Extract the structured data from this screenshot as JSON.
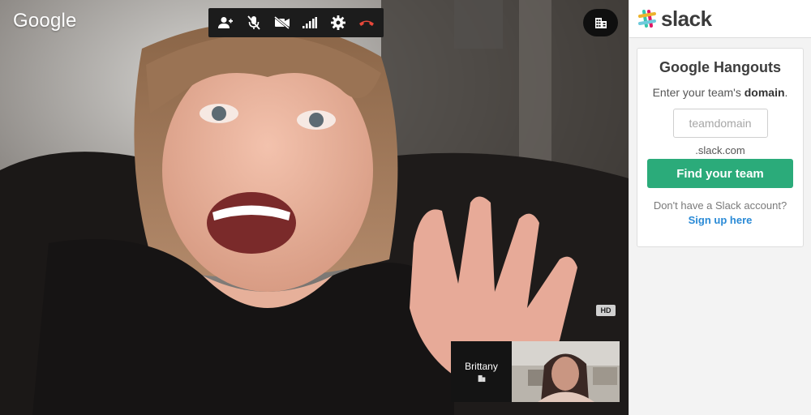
{
  "video": {
    "brand": "Google",
    "toolbar": {
      "icons": [
        "add-person-icon",
        "mute-mic-icon",
        "camera-off-icon",
        "signal-icon",
        "settings-gear-icon",
        "hangup-icon"
      ],
      "hangup_color": "#e8473a"
    },
    "building_icon": "building-icon",
    "hd_badge": "HD",
    "participant": {
      "name": "Brittany",
      "icon": "building-icon"
    }
  },
  "slack": {
    "wordmark": "slack",
    "card": {
      "title": "Google Hangouts",
      "instruction_prefix": "Enter your team's ",
      "instruction_bold": "domain",
      "instruction_suffix": ".",
      "domain_input": {
        "value": "",
        "placeholder": "teamdomain"
      },
      "domain_suffix": ".slack.com",
      "find_button": "Find your team",
      "no_account": "Don't have a Slack account?",
      "signup_link": "Sign up here"
    },
    "colors": {
      "button": "#2bab7a",
      "link": "#2a8ad6"
    }
  }
}
